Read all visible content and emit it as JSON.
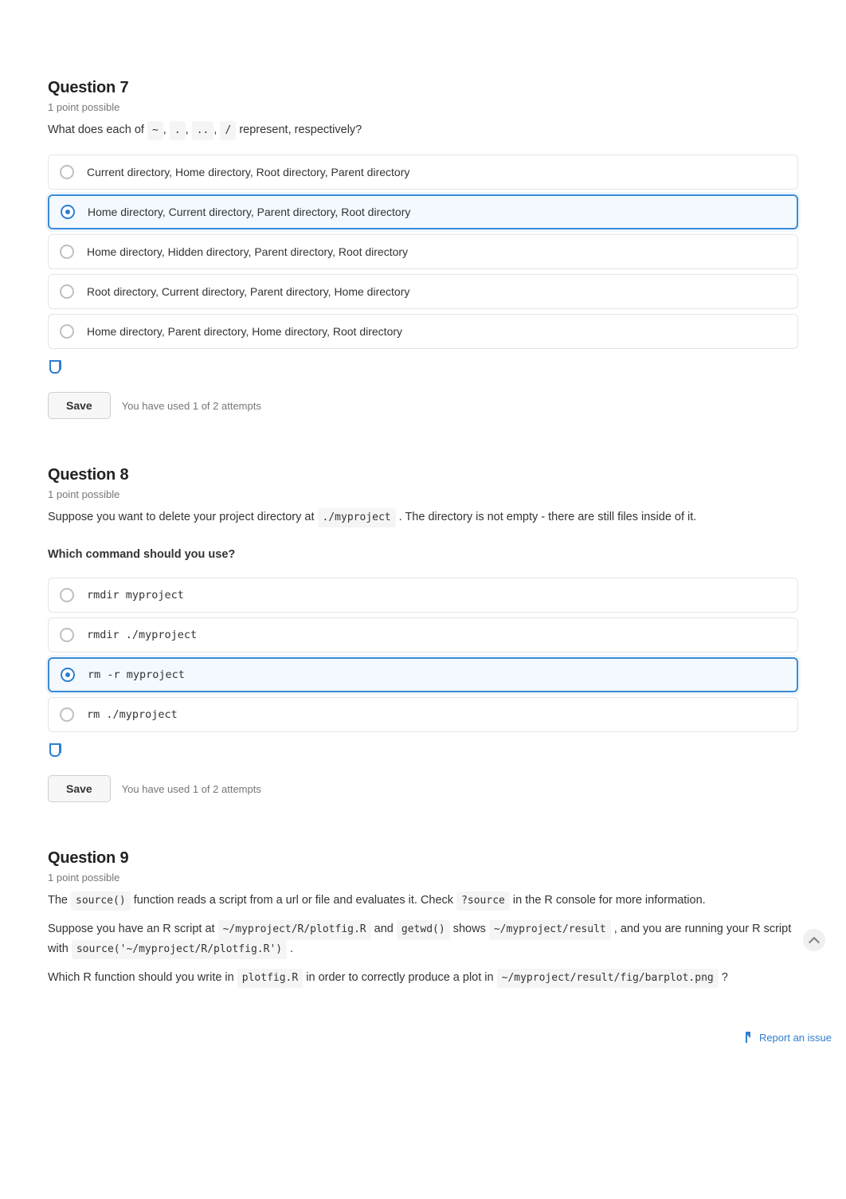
{
  "q7": {
    "title_prefix": "Question",
    "number": "7",
    "points": "1 point possible",
    "prompt_lead": "What does each of",
    "chips": [
      "~",
      ".",
      "..",
      "/"
    ],
    "prompt_tail": "represent, respectively?",
    "options": [
      "Current directory, Home directory, Root directory, Parent directory",
      "Home directory, Current directory, Parent directory, Root directory",
      "Home directory, Hidden directory, Parent directory, Root directory",
      "Root directory, Current directory, Parent directory, Home directory",
      "Home directory, Parent directory, Home directory, Root directory"
    ],
    "selected": 1
  },
  "q8": {
    "title_prefix": "Question",
    "number": "8",
    "points": "1 point possible",
    "prompt_part1": "Suppose you want to delete your project directory at",
    "chip1": "./myproject",
    "prompt_part2": ". The directory is not empty - there are still files inside of it.",
    "prompt_strong": "Which command should you use?",
    "options": [
      "rmdir myproject",
      "rmdir ./myproject",
      "rm -r myproject",
      "rm ./myproject"
    ],
    "selected": 2
  },
  "q9": {
    "title_prefix": "Question",
    "number": "9",
    "points": "1 point possible",
    "p1_a": "The",
    "chip_source": "source()",
    "p1_b": "function reads a script from a url or file and evaluates it. Check",
    "chip_help": "?source",
    "p1_c": "in the R console for more information.",
    "p2_a": "Suppose you have an R script at",
    "chip_path": "~/myproject/R/plotfig.R",
    "p2_b": "and",
    "chip_getwd": "getwd()",
    "p2_c": "shows",
    "chip_result": "~/myproject/result",
    "p2_d": ", and you are running your R script with",
    "chip_call": "source('~/myproject/R/plotfig.R')",
    "p2_e": ".",
    "p3_a": "Which R function should you write in",
    "chip_plotfig": "plotfig.R",
    "p3_b": "in order to correctly produce a plot in",
    "chip_out": "~/myproject/result/fig/barplot.png",
    "p3_c": "?"
  },
  "save_label": "Save",
  "save_hint": "You have used 1 of 2 attempts",
  "report_label": "Report an issue"
}
